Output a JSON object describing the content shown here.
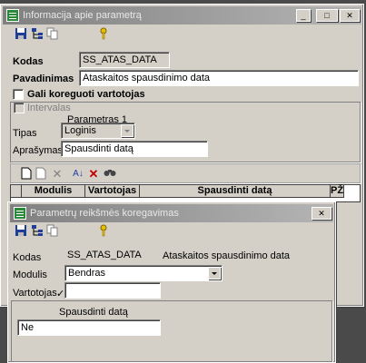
{
  "colors": {
    "desktop": "#4a4a4a",
    "window_face": "#d4d0c8",
    "inactive_title_start": "#808080",
    "inactive_title_end": "#b5b5b5",
    "app_icon": "#2a8a3a",
    "key_icon": "#e8c000"
  },
  "main_window": {
    "title": "Informacija apie parametrą",
    "title_buttons": {
      "minimize": "_",
      "maximize": "□",
      "close": "✕"
    },
    "toolbar": [
      "save-icon",
      "tree-icon",
      "copy-icon",
      "key-icon"
    ],
    "kodas_label": "Kodas",
    "kodas_value": "SS_ATAS_DATA",
    "pavadinimas_label": "Pavadinimas",
    "pavadinimas_value": "Ataskaitos spausdinimo data",
    "gali_label": "Gali koreguoti vartotojas",
    "intervalas_label": "Intervalas",
    "param_header": "Parametras 1",
    "tipas_label": "Tipas",
    "tipas_value": "Loginis",
    "aprasymas_label": "Aprašymas",
    "aprasymas_value": "Spausdinti datą",
    "grid_toolbar": [
      "new-icon",
      "edit-icon",
      "delete-icon",
      "sort-icon",
      "cancel-icon",
      "find-icon"
    ],
    "grid_columns": [
      "Modulis",
      "Vartotojas",
      "Spausdinti datą",
      "PŽ"
    ]
  },
  "sub_window": {
    "title": "Parametrų reikšmės koregavimas",
    "title_buttons": {
      "close": "✕"
    },
    "toolbar": [
      "save-icon",
      "tree-icon",
      "copy-icon",
      "key-icon"
    ],
    "kodas_label": "Kodas",
    "kodas_value": "SS_ATAS_DATA",
    "kodas_desc": "Ataskaitos spausdinimo data",
    "modulis_label": "Modulis",
    "modulis_value": "Bendras",
    "vartotojas_label": "Vartotojas",
    "vartotojas_mark": "✓",
    "vartotojas_value": "",
    "value_caption": "Spausdinti datą",
    "value": "Ne"
  }
}
